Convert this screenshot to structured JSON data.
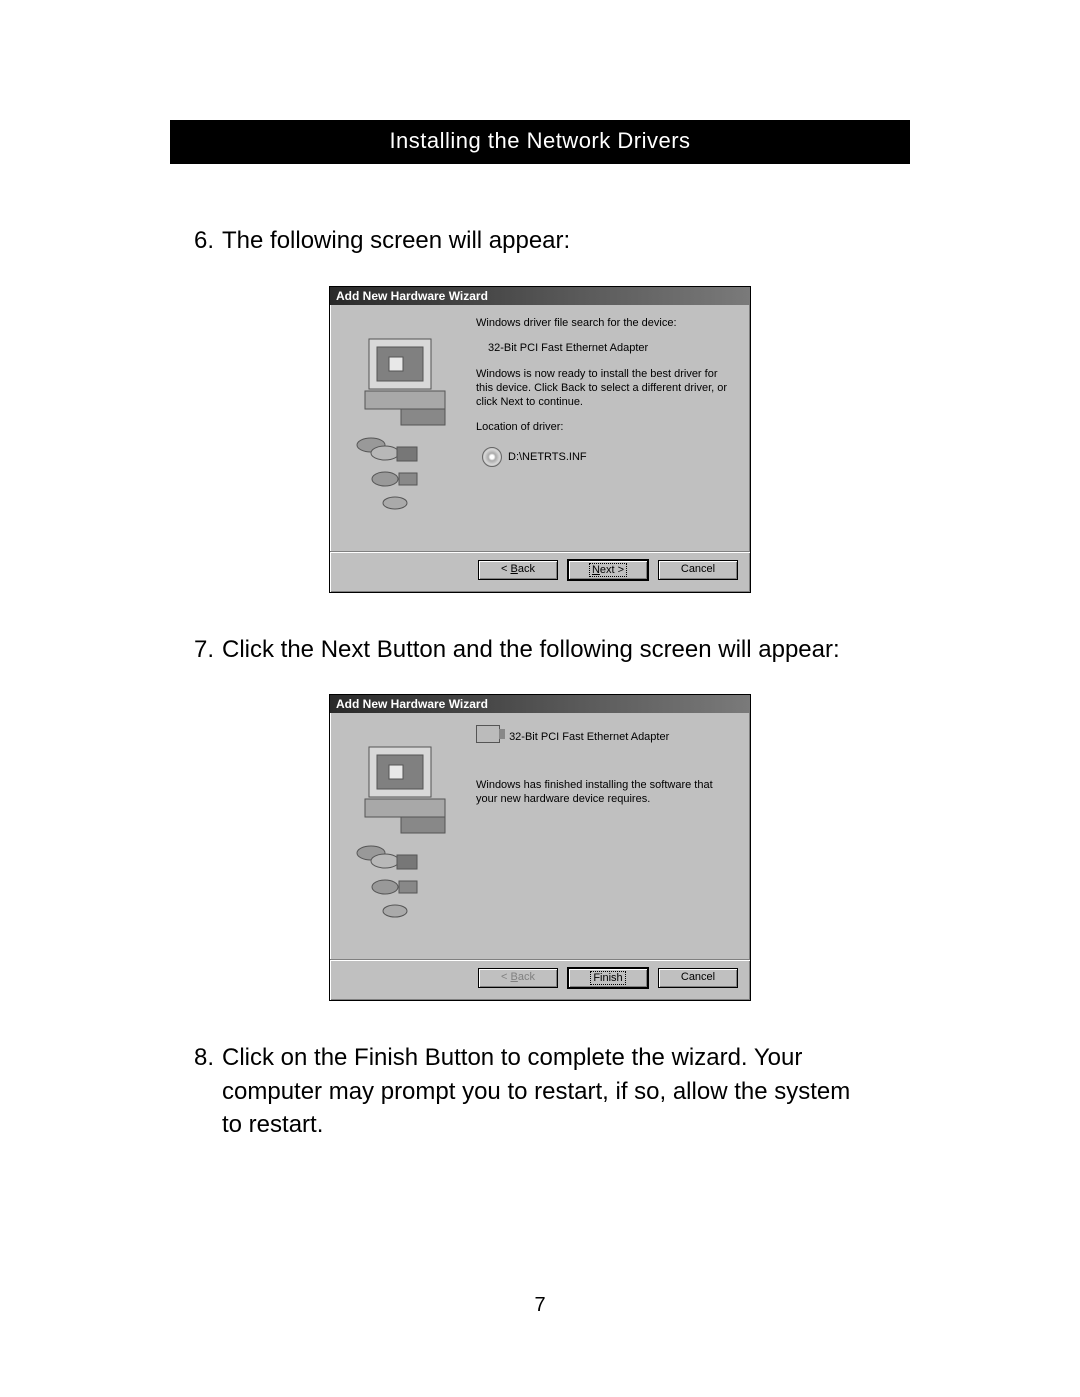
{
  "header": {
    "title": "Installing the Network Drivers"
  },
  "steps": {
    "s6": {
      "num": "6.",
      "text": "The following screen will appear:"
    },
    "s7": {
      "num": "7.",
      "text": "Click the Next Button and the following screen will appear:"
    },
    "s8": {
      "num": "8.",
      "text": "Click on the Finish Button to complete the wizard. Your computer may prompt you to restart, if so, allow the system to restart."
    }
  },
  "wizard1": {
    "title": "Add New Hardware Wizard",
    "line1": "Windows driver file search for the device:",
    "device": "32-Bit PCI Fast Ethernet Adapter",
    "line2": "Windows is now ready to install the best driver for this device. Click Back to select a different driver, or click Next to continue.",
    "loc_label": "Location of driver:",
    "loc_value": "D:\\NETRTS.INF",
    "buttons": {
      "back_pre": "< ",
      "back_u": "B",
      "back_post": "ack",
      "next_pre": "",
      "next_u": "N",
      "next_post": "ext >",
      "cancel": "Cancel"
    }
  },
  "wizard2": {
    "title": "Add New Hardware Wizard",
    "device": "32-Bit PCI Fast Ethernet Adapter",
    "line1": "Windows has finished installing the software that your new hardware device requires.",
    "buttons": {
      "back_pre": "< ",
      "back_u": "B",
      "back_post": "ack",
      "finish": "Finish",
      "cancel": "Cancel"
    }
  },
  "page_number": "7"
}
